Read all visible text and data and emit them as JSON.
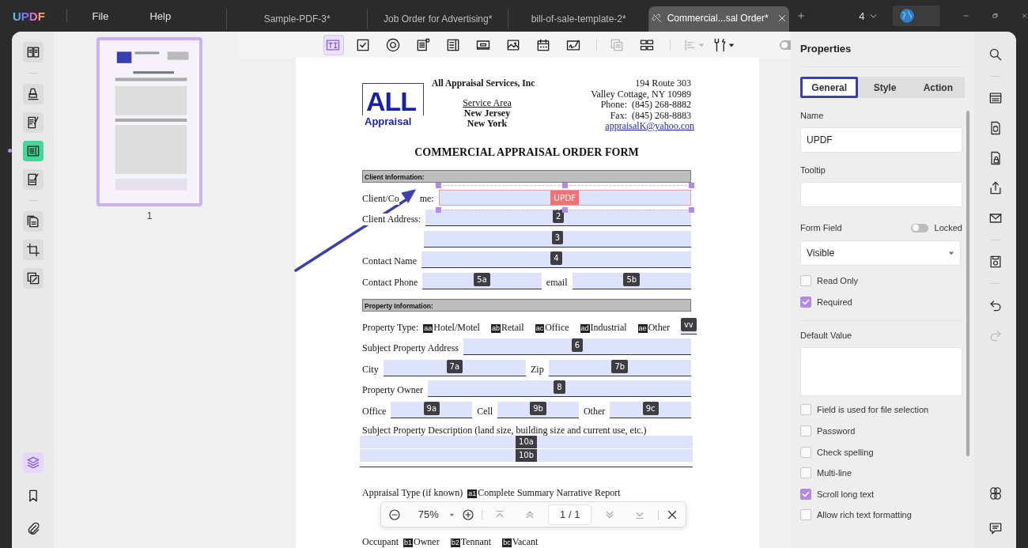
{
  "app_menu": {
    "logo": "UPDF",
    "items": [
      "File",
      "Help"
    ]
  },
  "tabs": [
    {
      "title": "Sample-PDF-3*",
      "selected": false
    },
    {
      "title": "Job Order for Advertising*",
      "selected": false
    },
    {
      "title": "bill-of-sale-template-2*",
      "selected": false
    },
    {
      "title": "Commercial...sal Order*",
      "selected": true
    }
  ],
  "window_count": "4",
  "left_rail": {
    "groups": [
      [
        {
          "kind": "reader",
          "selected": false
        }
      ],
      [
        {
          "kind": "highlight",
          "selected": false
        },
        {
          "kind": "edit",
          "selected": false
        },
        {
          "kind": "form",
          "selected": true
        },
        {
          "kind": "fillsign",
          "selected": false
        }
      ],
      [
        {
          "kind": "organize",
          "selected": false
        },
        {
          "kind": "crop",
          "selected": false
        },
        {
          "kind": "pages",
          "selected": false
        }
      ]
    ],
    "bottom": [
      {
        "kind": "layers",
        "selected": true
      },
      {
        "kind": "bookmark",
        "selected": false
      },
      {
        "kind": "attachment",
        "selected": false
      }
    ]
  },
  "thumbnails": [
    {
      "label": "1",
      "selected": true
    }
  ],
  "form_tools": {
    "groups": [
      [
        {
          "kind": "textfield",
          "selected": true,
          "disabled": false
        },
        {
          "kind": "checkbox",
          "selected": false,
          "disabled": false
        },
        {
          "kind": "radio",
          "selected": false,
          "disabled": false
        },
        {
          "kind": "listbox",
          "selected": false,
          "disabled": false
        },
        {
          "kind": "dropdown",
          "selected": false,
          "disabled": false
        },
        {
          "kind": "button",
          "selected": false,
          "disabled": false
        },
        {
          "kind": "image",
          "selected": false,
          "disabled": false
        },
        {
          "kind": "date",
          "selected": false,
          "disabled": false
        },
        {
          "kind": "signature",
          "selected": false,
          "disabled": false
        }
      ],
      [
        {
          "kind": "duplicate",
          "selected": false,
          "disabled": true
        },
        {
          "kind": "grid",
          "selected": false,
          "disabled": false
        }
      ],
      [
        {
          "kind": "align",
          "selected": false,
          "disabled": true
        },
        {
          "kind": "tools",
          "selected": false,
          "disabled": false
        }
      ]
    ],
    "panel_toggle_on": false
  },
  "document": {
    "logo": {
      "big": "ALL",
      "small": "Appraisal"
    },
    "company": "All Appraisal Services, Inc",
    "service_area": "Service Area",
    "states": [
      "New Jersey",
      "New York"
    ],
    "contact_lines": [
      "194 Route 303",
      "Valley Cottage, NY 10989",
      "Phone:  (845) 268-8882",
      "Fax:  (845) 268-8883"
    ],
    "email": "appraisalK@yahoo.con",
    "title": "COMMERCIAL APPRAISAL ORDER FORM",
    "rows": [
      {
        "kind": "section",
        "text": "Client Information:"
      },
      {
        "kind": "line",
        "items": [
          {
            "kind": "label",
            "parts": [
              "Client/Co",
              "me:"
            ]
          },
          {
            "kind": "field",
            "tag": "UPDF",
            "selected": true
          }
        ]
      },
      {
        "kind": "line",
        "items": [
          {
            "kind": "label",
            "parts": [
              "Client Address:"
            ]
          },
          {
            "kind": "field",
            "tag": "2",
            "selected": false
          }
        ]
      },
      {
        "kind": "line",
        "items": [
          {
            "kind": "field",
            "tag": "3",
            "selected": false
          }
        ]
      },
      {
        "kind": "line",
        "items": [
          {
            "kind": "label",
            "parts": [
              "Contact Name"
            ]
          },
          {
            "kind": "field",
            "tag": "4",
            "selected": false
          }
        ]
      },
      {
        "kind": "line",
        "items": [
          {
            "kind": "label",
            "parts": [
              "Contact Phone"
            ]
          },
          {
            "kind": "field",
            "tag": "5a",
            "selected": false
          },
          {
            "kind": "label",
            "parts": [
              "email"
            ]
          },
          {
            "kind": "field",
            "tag": "5b",
            "selected": false
          }
        ]
      },
      {
        "kind": "section",
        "text": "Property Information:"
      },
      {
        "kind": "line",
        "items": [
          {
            "kind": "label",
            "parts": [
              "Property Type:"
            ]
          },
          {
            "kind": "option",
            "tag": "aa",
            "text": "Hotel/Motel"
          },
          {
            "kind": "option",
            "tag": "ab",
            "text": "Retail"
          },
          {
            "kind": "option",
            "tag": "ac",
            "text": "Office"
          },
          {
            "kind": "option",
            "tag": "ad",
            "text": "Industrial"
          },
          {
            "kind": "option",
            "tag": "ae",
            "text": "Other"
          },
          {
            "kind": "field",
            "tag": "vv",
            "selected": false
          }
        ]
      },
      {
        "kind": "line",
        "items": [
          {
            "kind": "label",
            "parts": [
              "Subject Property Address"
            ]
          },
          {
            "kind": "field",
            "tag": "6",
            "selected": false
          }
        ]
      },
      {
        "kind": "line",
        "items": [
          {
            "kind": "label",
            "parts": [
              "City"
            ]
          },
          {
            "kind": "field",
            "tag": "7a",
            "selected": false
          },
          {
            "kind": "label",
            "parts": [
              "Zip"
            ]
          },
          {
            "kind": "field",
            "tag": "7b",
            "selected": false
          }
        ]
      },
      {
        "kind": "line",
        "items": [
          {
            "kind": "label",
            "parts": [
              "Property Owner"
            ]
          },
          {
            "kind": "field",
            "tag": "8",
            "selected": false
          }
        ]
      },
      {
        "kind": "line",
        "items": [
          {
            "kind": "label",
            "parts": [
              "Office"
            ]
          },
          {
            "kind": "field",
            "tag": "9a",
            "selected": false
          },
          {
            "kind": "label",
            "parts": [
              "Cell"
            ]
          },
          {
            "kind": "field",
            "tag": "9b",
            "selected": false
          },
          {
            "kind": "label",
            "parts": [
              "Other"
            ]
          },
          {
            "kind": "field",
            "tag": "9c",
            "selected": false
          }
        ]
      },
      {
        "kind": "text",
        "text": "Subject Property Description (land size, building size and current use, etc.)"
      },
      {
        "kind": "bands",
        "items": [
          {
            "tag": "10a",
            "selected": false
          },
          {
            "tag": "10b",
            "selected": false
          }
        ]
      },
      {
        "kind": "line",
        "items": [
          {
            "kind": "label",
            "parts": [
              "Appraisal Type (if known)"
            ]
          },
          {
            "kind": "option",
            "tag": "a1",
            "text": "Complete Summary Narrative Report"
          }
        ]
      },
      {
        "kind": "line",
        "items": [
          {
            "kind": "label",
            "parts": [
              "Occupant"
            ]
          },
          {
            "kind": "option",
            "tag": "b1",
            "text": "Owner"
          },
          {
            "kind": "option",
            "tag": "b2",
            "text": "Tennant"
          },
          {
            "kind": "option",
            "tag": "bc",
            "text": "Vacant"
          }
        ]
      }
    ]
  },
  "zoom_bar": {
    "zoom": "75%",
    "page": "1 / 1"
  },
  "properties": {
    "title": "Properties",
    "tabs": [
      {
        "label": "General",
        "selected": true
      },
      {
        "label": "Style",
        "selected": false
      },
      {
        "label": "Action",
        "selected": false
      }
    ],
    "name_label": "Name",
    "name_value": "UPDF",
    "tooltip_label": "Tooltip",
    "form_field_label": "Form Field",
    "locked": {
      "label": "Locked",
      "on": false
    },
    "visibility": "Visible",
    "options_a": [
      {
        "label": "Read Only",
        "checked": false
      },
      {
        "label": "Required",
        "checked": true
      }
    ],
    "default_value_label": "Default Value",
    "options_b": [
      {
        "label": "Field is used for file selection",
        "checked": false
      },
      {
        "label": "Password",
        "checked": false
      },
      {
        "label": "Check spelling",
        "checked": false
      },
      {
        "label": "Multi-line",
        "checked": false
      },
      {
        "label": "Scroll long text",
        "checked": true
      },
      {
        "label": "Allow rich text formatting",
        "checked": false
      }
    ]
  },
  "right_rail": {
    "groups": [
      [
        {
          "kind": "search",
          "disabled": false
        }
      ],
      [
        {
          "kind": "ocr",
          "disabled": false
        },
        {
          "kind": "convert",
          "disabled": false
        },
        {
          "kind": "protect",
          "disabled": false
        },
        {
          "kind": "share",
          "disabled": false
        },
        {
          "kind": "mail",
          "disabled": false
        }
      ],
      [
        {
          "kind": "save",
          "disabled": false
        }
      ],
      [
        {
          "kind": "undo",
          "disabled": false
        },
        {
          "kind": "redo",
          "disabled": true
        }
      ]
    ],
    "bottom": [
      {
        "kind": "apps",
        "disabled": false
      },
      {
        "kind": "comment",
        "disabled": false
      }
    ]
  }
}
